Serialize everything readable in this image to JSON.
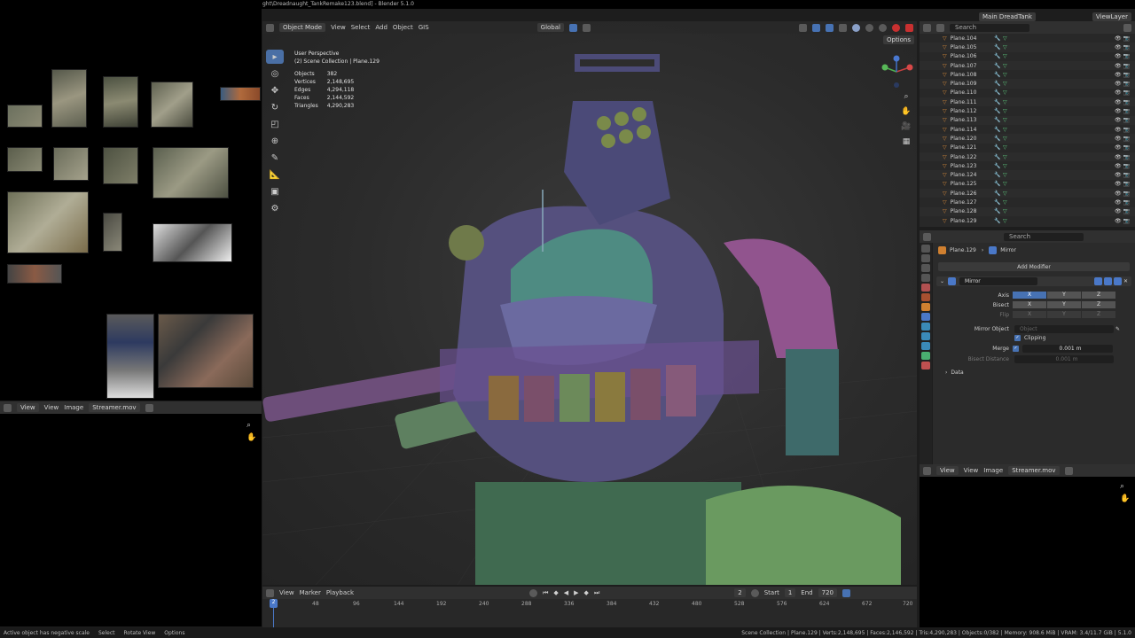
{
  "window": {
    "title": "ght\\Dreadnaught_TankRemake123.blend] - Blender 5.1.0"
  },
  "viewport": {
    "header": {
      "mode": "Object Mode",
      "menus": [
        "View",
        "Select",
        "Add",
        "Object",
        "GIS"
      ],
      "transform_orientation": "Global",
      "options_label": "Options"
    },
    "overlay": {
      "view_name": "User Perspective",
      "collection": "(2) Scene Collection | Plane.129",
      "stats": [
        {
          "label": "Objects",
          "value": "382"
        },
        {
          "label": "Vertices",
          "value": "2,148,695"
        },
        {
          "label": "Edges",
          "value": "4,294,118"
        },
        {
          "label": "Faces",
          "value": "2,144,592"
        },
        {
          "label": "Triangles",
          "value": "4,290,283"
        }
      ]
    }
  },
  "left_editor": {
    "menus": [
      "View",
      "View",
      "Image"
    ],
    "image_name": "Streamer.mov"
  },
  "timeline": {
    "menus": [
      "View",
      "Marker",
      "Playback"
    ],
    "current_frame": "2",
    "start_label": "Start",
    "start_value": "1",
    "end_label": "End",
    "end_value": "720",
    "ticks": [
      "2",
      "48",
      "96",
      "144",
      "192",
      "240",
      "288",
      "336",
      "384",
      "432",
      "480",
      "528",
      "576",
      "624",
      "672",
      "720"
    ]
  },
  "status_bar": {
    "left": [
      "Active object has negative scale",
      "Select",
      "Rotate View",
      "Options"
    ],
    "right": "Scene Collection | Plane.129 | Verts:2,148,695 | Faces:2,146,592 | Tris:4,290,283 | Objects:0/382 | Memory: 908.6 MiB | VRAM: 3.4/11.7 GiB | 5.1.0"
  },
  "topbar_right": {
    "scene": "Main DreadTank",
    "view_layer": "ViewLayer"
  },
  "outliner": {
    "search_placeholder": "Search",
    "items": [
      "Plane.104",
      "Plane.105",
      "Plane.106",
      "Plane.107",
      "Plane.108",
      "Plane.109",
      "Plane.110",
      "Plane.111",
      "Plane.112",
      "Plane.113",
      "Plane.114",
      "Plane.120",
      "Plane.121",
      "Plane.122",
      "Plane.123",
      "Plane.124",
      "Plane.125",
      "Plane.126",
      "Plane.127",
      "Plane.128",
      "Plane.129"
    ]
  },
  "properties": {
    "search_placeholder": "Search",
    "breadcrumb_object": "Plane.129",
    "breadcrumb_modifier": "Mirror",
    "add_modifier": "Add Modifier",
    "modifier_name": "Mirror",
    "axis_label": "Axis",
    "bisect_label": "Bisect",
    "flip_label": "Flip",
    "axes": [
      "X",
      "Y",
      "Z"
    ],
    "mirror_object_label": "Mirror Object",
    "mirror_object_placeholder": "Object",
    "clipping_label": "Clipping",
    "merge_label": "Merge",
    "merge_value": "0.001 m",
    "bisect_distance_label": "Bisect Distance",
    "bisect_distance_value": "0.001 m",
    "data_panel": "Data"
  },
  "right_image_editor": {
    "menus": [
      "View",
      "View",
      "Image"
    ],
    "image_name": "Streamer.mov"
  },
  "colors": {
    "accent": "#4772b3",
    "outliner_object": "#d98b3a",
    "modifier_icon": "#4fb0d8",
    "mesh_icon": "#5fcf80"
  }
}
